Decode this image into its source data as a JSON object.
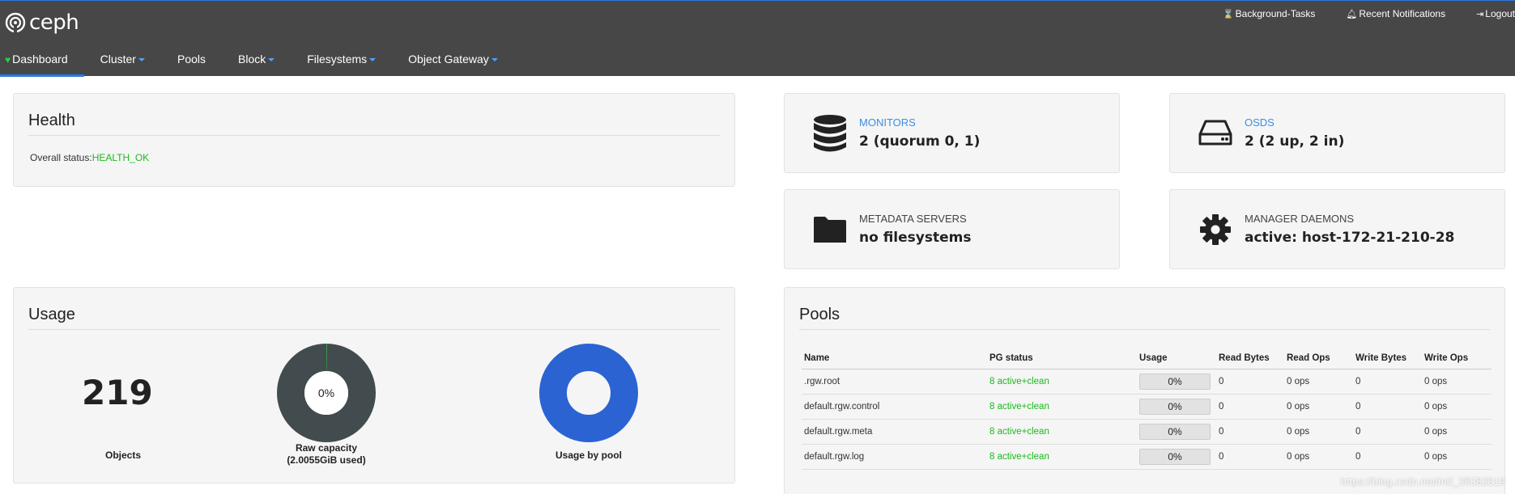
{
  "app": {
    "logo_text": "ceph"
  },
  "util_nav": {
    "background_tasks": "Background-Tasks",
    "recent_notifications": "Recent Notifications",
    "logout": "Logout"
  },
  "main_nav": {
    "dashboard": "Dashboard",
    "cluster": "Cluster",
    "pools": "Pools",
    "block": "Block",
    "filesystems": "Filesystems",
    "object_gateway": "Object Gateway"
  },
  "health": {
    "title": "Health",
    "status_label": "Overall status:",
    "status_value": "HEALTH_OK"
  },
  "monitors": {
    "label": "MONITORS",
    "value": "2 (quorum 0, 1)"
  },
  "osds": {
    "label": "OSDS",
    "value": "2 (2 up, 2 in)"
  },
  "mds": {
    "label": "METADATA SERVERS",
    "value": "no filesystems"
  },
  "mgr": {
    "label": "MANAGER DAEMONS",
    "value": "active: host-172-21-210-28"
  },
  "usage": {
    "title": "Usage",
    "objects_count": "219",
    "objects_label": "Objects",
    "raw_capacity_percent": "0%",
    "raw_capacity_fraction": 0.002,
    "raw_capacity_label_line1": "Raw capacity",
    "raw_capacity_label_line2": "(2.0055GiB used)",
    "usage_by_pool_label": "Usage by pool"
  },
  "pools": {
    "title": "Pools",
    "columns": [
      "Name",
      "PG status",
      "Usage",
      "Read Bytes",
      "Read Ops",
      "Write Bytes",
      "Write Ops"
    ],
    "rows": [
      {
        "name": ".rgw.root",
        "pg_status": "8 active+clean",
        "usage": "0%",
        "read_bytes": "0",
        "read_ops": "0 ops",
        "write_bytes": "0",
        "write_ops": "0 ops"
      },
      {
        "name": "default.rgw.control",
        "pg_status": "8 active+clean",
        "usage": "0%",
        "read_bytes": "0",
        "read_ops": "0 ops",
        "write_bytes": "0",
        "write_ops": "0 ops"
      },
      {
        "name": "default.rgw.meta",
        "pg_status": "8 active+clean",
        "usage": "0%",
        "read_bytes": "0",
        "read_ops": "0 ops",
        "write_bytes": "0",
        "write_ops": "0 ops"
      },
      {
        "name": "default.rgw.log",
        "pg_status": "8 active+clean",
        "usage": "0%",
        "read_bytes": "0",
        "read_ops": "0 ops",
        "write_bytes": "0",
        "write_ops": "0 ops"
      }
    ]
  },
  "watermark": "https://blog.csdn.net/m0_38082819",
  "colors": {
    "topbar": "#474747",
    "accent": "#2b78e4",
    "ok_green": "#1db81d",
    "donut_dark": "#424b4e",
    "donut_blue": "#2b63d2"
  }
}
